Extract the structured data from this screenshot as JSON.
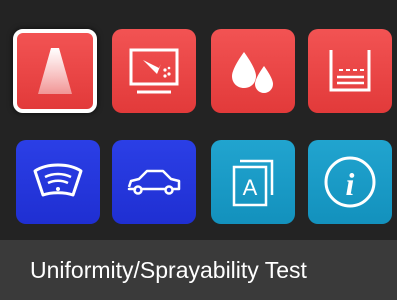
{
  "tiles": [
    {
      "icon": "spray-cone-icon",
      "color": "#e23a3a",
      "selected": true
    },
    {
      "icon": "spray-on-screen-icon",
      "color": "#e23a3a",
      "selected": false
    },
    {
      "icon": "droplets-icon",
      "color": "#e23a3a",
      "selected": false
    },
    {
      "icon": "beaker-icon",
      "color": "#e23a3a",
      "selected": false
    },
    {
      "icon": "windshield-washer-icon",
      "color": "#1f2fd2",
      "selected": false
    },
    {
      "icon": "car-icon",
      "color": "#1f2fd2",
      "selected": false
    },
    {
      "icon": "language-a-icon",
      "color": "#1391bd",
      "selected": false,
      "glyph": "A"
    },
    {
      "icon": "info-icon",
      "color": "#1391bd",
      "selected": false,
      "glyph": "i"
    }
  ],
  "footer": {
    "label": "Uniformity/Sprayability Test"
  }
}
